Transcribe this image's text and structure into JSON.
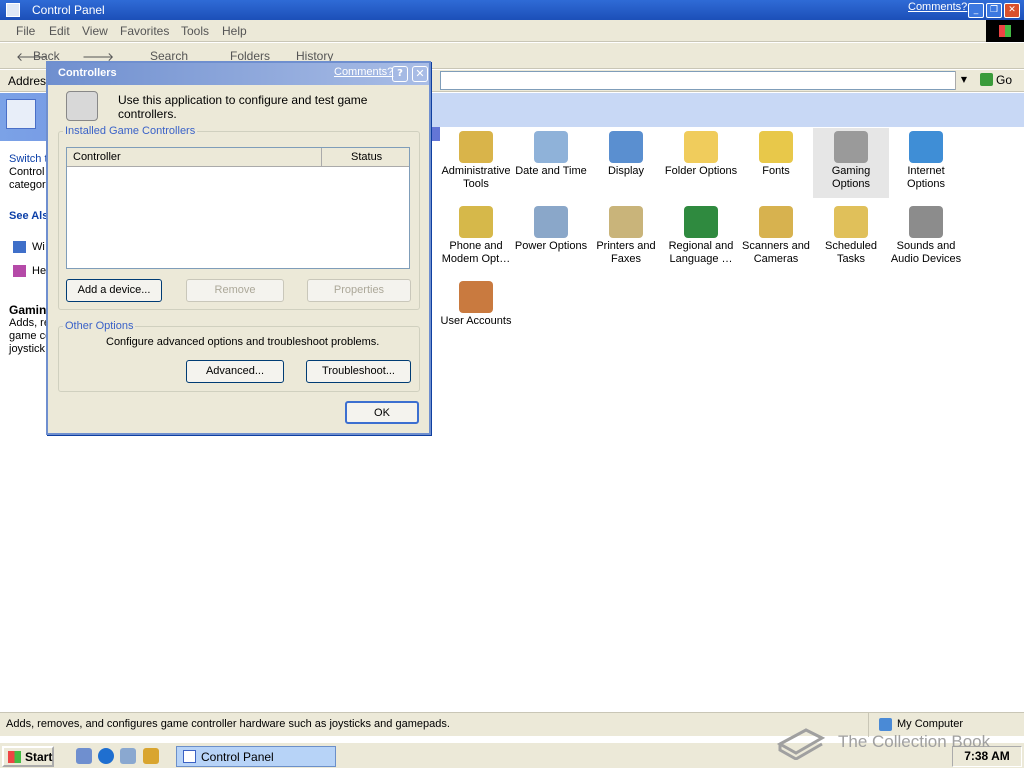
{
  "window": {
    "title": "Control Panel",
    "comments_link": "Comments?"
  },
  "menu": [
    "File",
    "Edit",
    "View",
    "Favorites",
    "Tools",
    "Help"
  ],
  "toolbar": {
    "back": "Back",
    "search": "Search",
    "folders": "Folders",
    "history": "History"
  },
  "address": {
    "label": "Address",
    "go": "Go"
  },
  "leftpane": {
    "switch_fragments": [
      "Switch t",
      "Control",
      "categor"
    ],
    "see_also": "See Als",
    "see_also_items": [
      "Wi",
      "He"
    ],
    "details_title": "Gamin",
    "details_fragments": [
      "Adds, re",
      "game co",
      "joystick"
    ]
  },
  "items": [
    {
      "label": "Administrative Tools",
      "icon": "administrative-tools-icon",
      "color": "#d9b44a"
    },
    {
      "label": "Date and Time",
      "icon": "date-time-icon",
      "color": "#8fb2d9"
    },
    {
      "label": "Display",
      "icon": "display-icon",
      "color": "#5a8fd0"
    },
    {
      "label": "Folder Options",
      "icon": "folder-options-icon",
      "color": "#f0cc5c"
    },
    {
      "label": "Fonts",
      "icon": "fonts-icon",
      "color": "#e8c84a"
    },
    {
      "label": "Gaming Options",
      "icon": "gaming-options-icon",
      "color": "#9a9a9a",
      "highlighted": true
    },
    {
      "label": "Internet Options",
      "icon": "internet-options-icon",
      "color": "#3f8ed6"
    },
    {
      "label": "Phone and Modem Opt…",
      "icon": "phone-modem-icon",
      "color": "#d6b84a"
    },
    {
      "label": "Power Options",
      "icon": "power-options-icon",
      "color": "#8aa7c9"
    },
    {
      "label": "Printers and Faxes",
      "icon": "printers-faxes-icon",
      "color": "#c9b47a"
    },
    {
      "label": "Regional and Language …",
      "icon": "regional-language-icon",
      "color": "#2f8a3f"
    },
    {
      "label": "Scanners and Cameras",
      "icon": "scanners-cameras-icon",
      "color": "#d7b24f"
    },
    {
      "label": "Scheduled Tasks",
      "icon": "scheduled-tasks-icon",
      "color": "#e0c05a"
    },
    {
      "label": "Sounds and Audio Devices",
      "icon": "sounds-audio-icon",
      "color": "#8c8c8c"
    },
    {
      "label": "User Accounts",
      "icon": "user-accounts-icon",
      "color": "#c97a3f"
    }
  ],
  "dialog": {
    "title": "Controllers",
    "comments": "Comments?",
    "help": "?",
    "intro": "Use this application to configure and test game controllers.",
    "installed_group": "Installed Game Controllers",
    "columns": [
      "Controller",
      "Status"
    ],
    "rows": [],
    "add_button": "Add a device...",
    "remove_button": "Remove",
    "properties_button": "Properties",
    "other_group": "Other Options",
    "other_text": "Configure advanced options and troubleshoot problems.",
    "advanced_button": "Advanced...",
    "troubleshoot_button": "Troubleshoot...",
    "ok_button": "OK"
  },
  "status": {
    "text": "Adds, removes, and configures game controller hardware such as joysticks and gamepads.",
    "zone": "My Computer"
  },
  "taskbar": {
    "start": "Start",
    "task": "Control Panel",
    "clock": "7:38 AM"
  },
  "watermark": "The Collection Book"
}
